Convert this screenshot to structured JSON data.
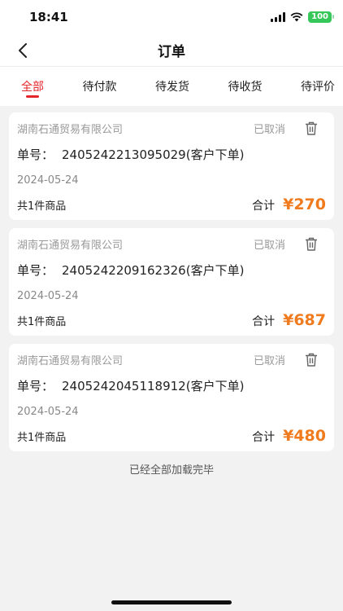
{
  "status_bar": {
    "time": "18:41",
    "battery": "100"
  },
  "nav": {
    "title": "订单"
  },
  "tabs": [
    {
      "label": "全部",
      "active": true
    },
    {
      "label": "待付款",
      "active": false
    },
    {
      "label": "待发货",
      "active": false
    },
    {
      "label": "待收货",
      "active": false
    },
    {
      "label": "待评价",
      "active": false
    }
  ],
  "orders": [
    {
      "company": "湖南石通贸易有限公司",
      "status": "已取消",
      "order_label": "单号：",
      "order_no": "2405242213095029(客户下单)",
      "date": "2024-05-24",
      "count": "共1件商品",
      "total_label": "合计",
      "price": "¥270"
    },
    {
      "company": "湖南石通贸易有限公司",
      "status": "已取消",
      "order_label": "单号：",
      "order_no": "2405242209162326(客户下单)",
      "date": "2024-05-24",
      "count": "共1件商品",
      "total_label": "合计",
      "price": "¥687"
    },
    {
      "company": "湖南石通贸易有限公司",
      "status": "已取消",
      "order_label": "单号：",
      "order_no": "2405242045118912(客户下单)",
      "date": "2024-05-24",
      "count": "共1件商品",
      "total_label": "合计",
      "price": "¥480"
    }
  ],
  "footer": {
    "end_text": "已经全部加载完毕"
  },
  "colors": {
    "accent": "#e3262b",
    "price": "#f07b1e",
    "battery": "#35c759"
  }
}
